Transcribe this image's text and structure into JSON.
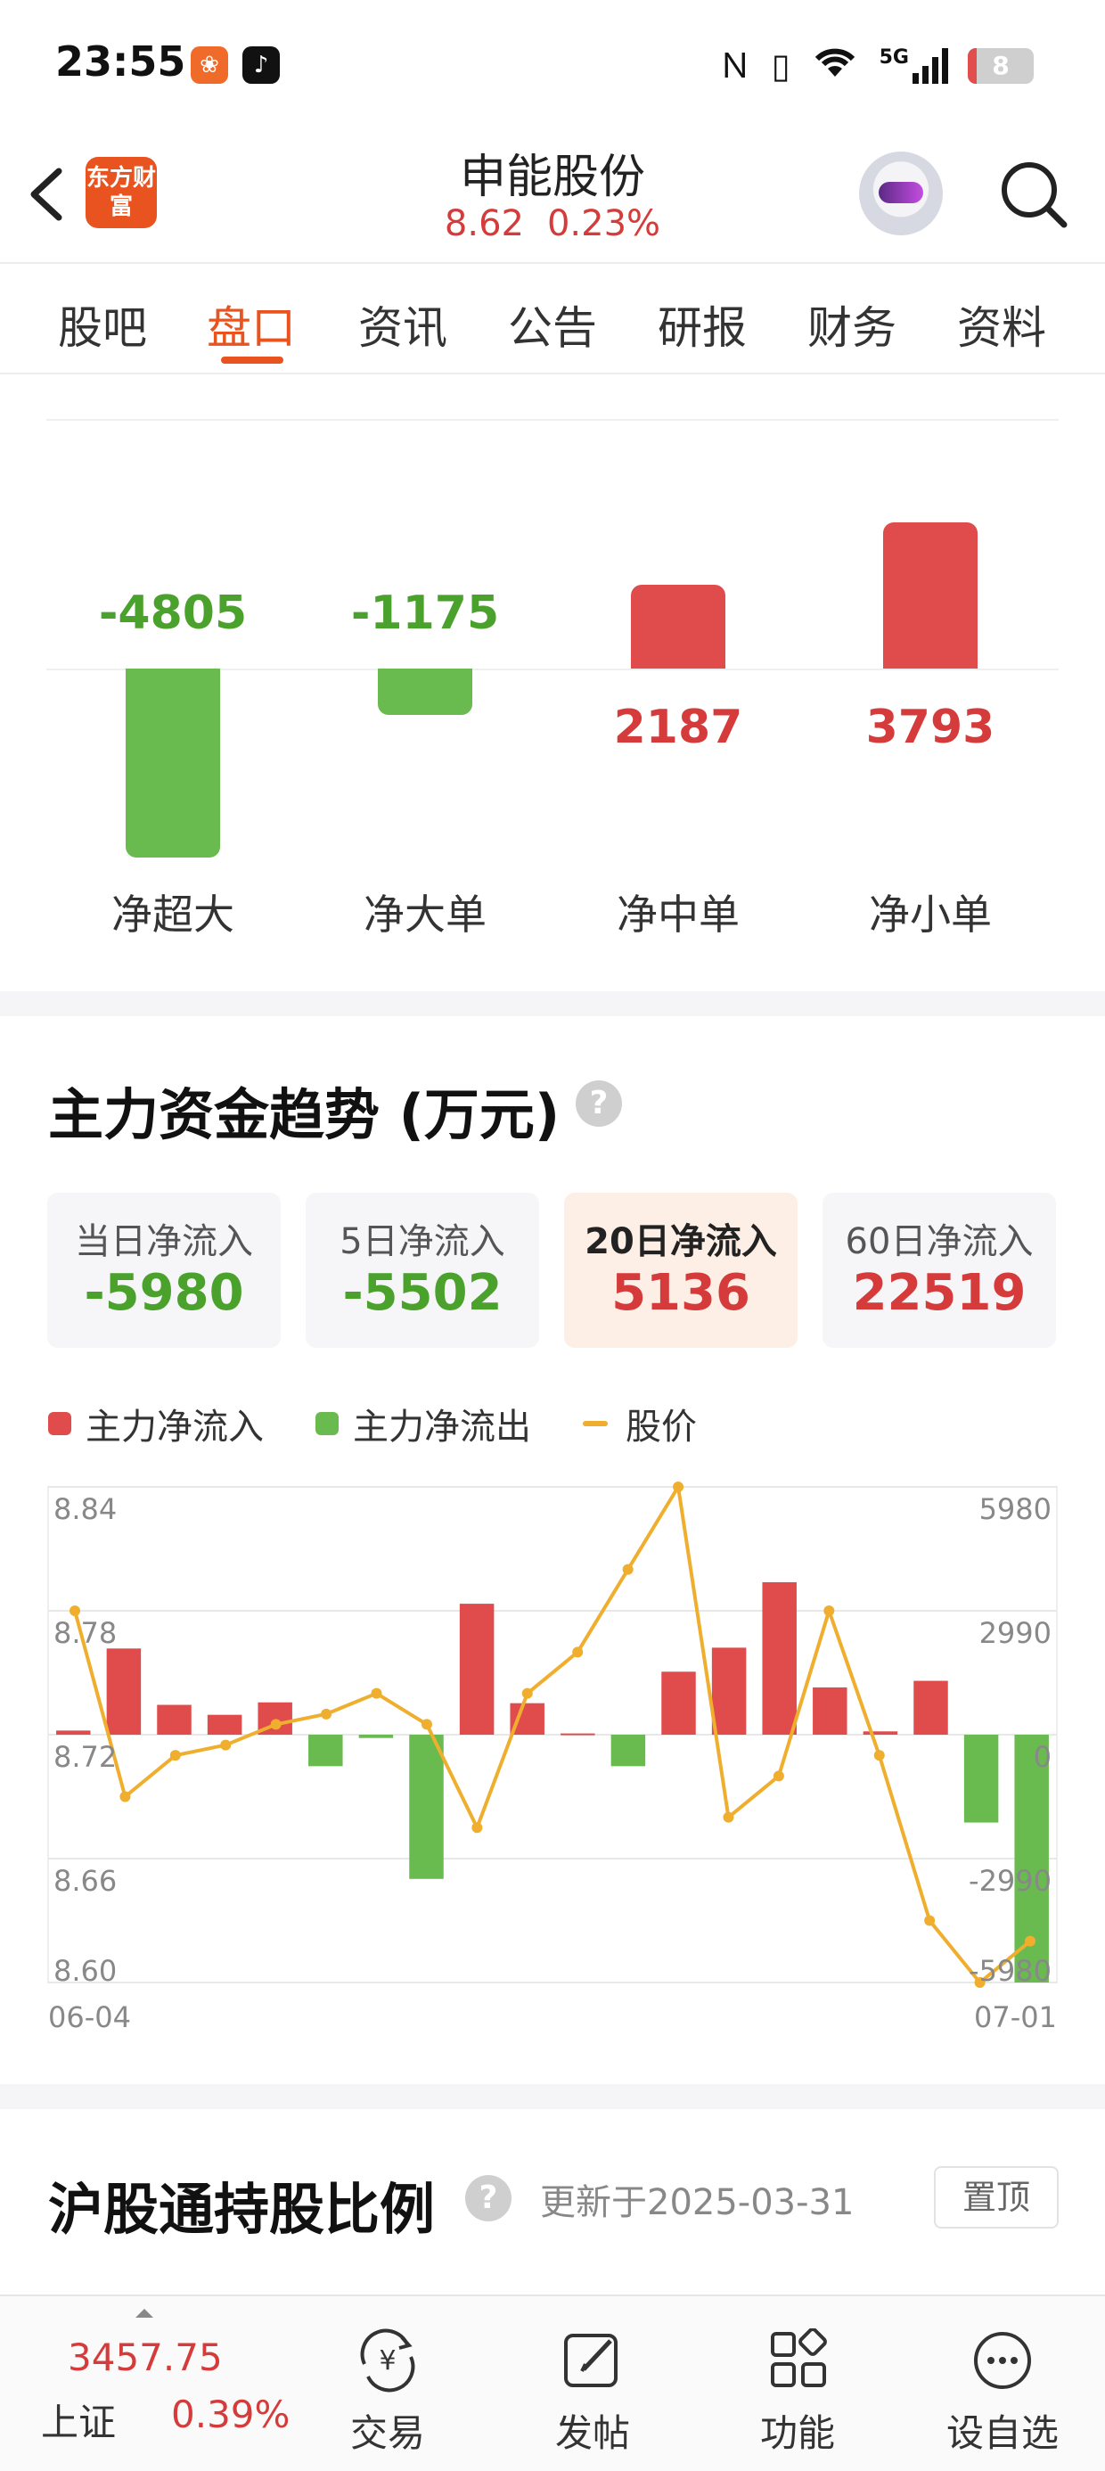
{
  "status_bar": {
    "time": "23:55",
    "battery": "8",
    "network": "5G",
    "icons": [
      "nfc-icon",
      "vibrate-icon",
      "wifi-icon",
      "signal-icon",
      "battery-icon"
    ]
  },
  "header": {
    "logo_text": "东方财富",
    "stock_name": "申能股份",
    "price": "8.62",
    "change_pct": "0.23%",
    "icons": [
      "back-icon",
      "assistant-avatar",
      "search-icon"
    ]
  },
  "tabs": [
    "股吧",
    "盘口",
    "资讯",
    "公告",
    "研报",
    "财务",
    "资料"
  ],
  "active_tab": "盘口",
  "net_orders": [
    {
      "label": "净超大",
      "value": "-4805"
    },
    {
      "label": "净大单",
      "value": "-1175"
    },
    {
      "label": "净中单",
      "value": "2187"
    },
    {
      "label": "净小单",
      "value": "3793"
    }
  ],
  "trend": {
    "title": "主力资金趋势 (万元)",
    "help": "?",
    "cards": [
      {
        "label": "当日净流入",
        "value": "-5980",
        "active": false
      },
      {
        "label": "5日净流入",
        "value": "-5502",
        "active": false
      },
      {
        "label": "20日净流入",
        "value": "5136",
        "active": true
      },
      {
        "label": "60日净流入",
        "value": "22519",
        "active": false
      }
    ],
    "legend": [
      "主力净流入",
      "主力净流出",
      "股价"
    ]
  },
  "chart_data": {
    "type": "bar+line",
    "legend": [
      "主力净流入",
      "主力净流出",
      "股价"
    ],
    "x_start_label": "06-04",
    "x_end_label": "07-01",
    "left_axis": {
      "ticks": [
        "8.84",
        "8.78",
        "8.72",
        "8.66",
        "8.60"
      ],
      "range": [
        8.6,
        8.84
      ]
    },
    "right_axis": {
      "ticks": [
        "5980",
        "2990",
        "0",
        "-2990",
        "-5980"
      ],
      "range": [
        -5980,
        5980
      ]
    },
    "series": [
      {
        "name": "主力净流入",
        "values": [
          100,
          2080,
          720,
          480,
          780,
          -760,
          -80,
          -3480,
          3160,
          760,
          30,
          -760,
          1520,
          2100,
          3680,
          1140,
          80,
          1300,
          -2120,
          -5980
        ]
      },
      {
        "name": "股价",
        "values": [
          8.78,
          8.69,
          8.71,
          8.715,
          8.725,
          8.73,
          8.74,
          8.725,
          8.675,
          8.74,
          8.76,
          8.8,
          8.84,
          8.68,
          8.7,
          8.78,
          8.71,
          8.63,
          8.6,
          8.62
        ]
      }
    ],
    "colors": {
      "inflow": "#e04c4c",
      "outflow": "#6abb4f",
      "price": "#efae2e"
    },
    "grid": true
  },
  "holding": {
    "title": "沪股通持股比例",
    "help": "?",
    "updated": "更新于2025-03-31",
    "pin_label": "置顶"
  },
  "bottom_bar": {
    "index_value": "3457.75",
    "index_name": "上证",
    "index_pct": "0.39%",
    "items": [
      "交易",
      "发帖",
      "功能",
      "设自选"
    ]
  },
  "colors": {
    "up": "#d63b3b",
    "down": "#4aa12c",
    "accent": "#e8531f"
  }
}
